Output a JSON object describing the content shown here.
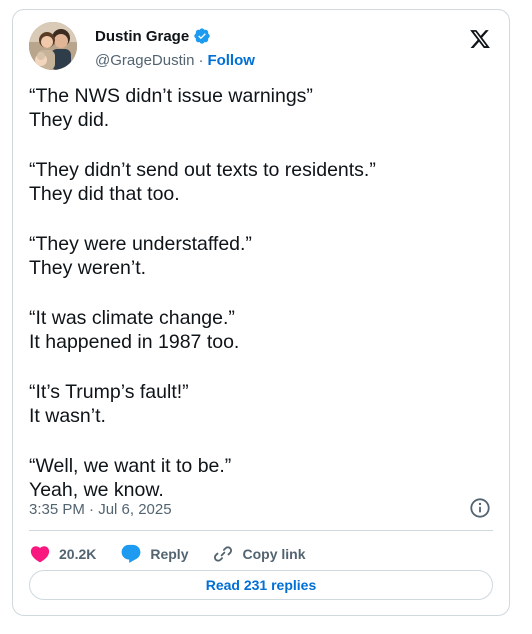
{
  "author": {
    "display_name": "Dustin Grage",
    "handle": "@GrageDustin",
    "separator": "·",
    "follow_label": "Follow",
    "verified": true
  },
  "tweet": {
    "lines": [
      "“The NWS didn’t issue warnings”",
      "They did.",
      "“They didn’t send out texts to residents.”",
      "They did that too.",
      "“They were understaffed.”",
      "They weren’t.",
      "“It was climate change.”",
      "It happened in 1987 too.",
      "“It’s Trump’s fault!”",
      "It wasn’t.",
      "“Well, we want it to be.”",
      "Yeah, we know."
    ],
    "timestamp": "3:35 PM · Jul 6, 2025"
  },
  "actions": {
    "like_count": "20.2K",
    "reply_label": "Reply",
    "copy_link_label": "Copy link"
  },
  "read_replies_label": "Read 231 replies",
  "colors": {
    "accent": "#006fd6",
    "verified": "#1d9bf0",
    "like": "#f91880",
    "reply_icon": "#1d9bf0",
    "muted": "#536471",
    "border": "#cfd9de"
  },
  "icons": {
    "verified": "verified-badge-icon",
    "x_logo": "x-logo-icon",
    "info": "info-icon",
    "like": "heart-icon",
    "reply": "speech-bubble-icon",
    "copy_link": "link-icon"
  }
}
